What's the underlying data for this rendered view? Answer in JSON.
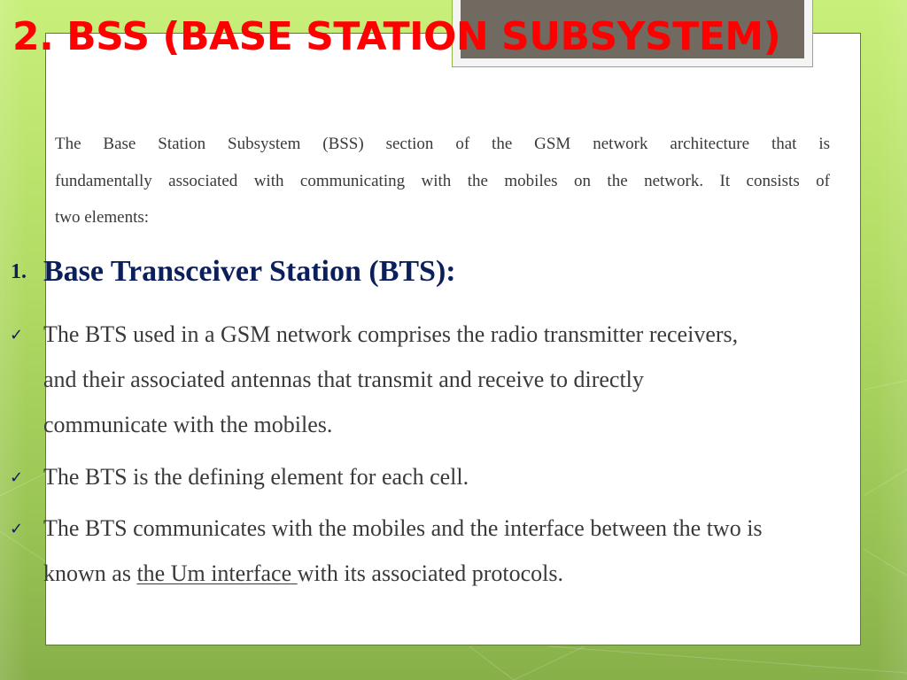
{
  "slide": {
    "title": "2. BSS (BASE STATION SUBSYSTEM)",
    "intro_lines": [
      "The Base Station Subsystem (BSS) section of the GSM network architecture that is",
      "fundamentally associated with communicating with the mobiles on the network. It consists of",
      "two elements:"
    ],
    "section": {
      "number": "1.",
      "heading": "Base Transceiver Station (BTS):"
    },
    "bullet_icon": "check-mark-icon",
    "bullets": [
      {
        "lines": [
          " The BTS used in a GSM network comprises the radio transmitter receivers,",
          "and their associated antennas that transmit and receive to directly",
          "communicate with the mobiles."
        ]
      },
      {
        "lines": [
          "The BTS is the defining element for each cell."
        ]
      },
      {
        "line1": "The BTS communicates with the mobiles and the interface between the two is",
        "line2_prefix": "known as ",
        "line2_underlined": "the Um interface ",
        "line2_suffix": "with its associated protocols."
      }
    ],
    "colors": {
      "title": "#ff0000",
      "heading": "#0b1f5c",
      "body": "#3a3a3a",
      "title_box": "#706a60",
      "background": "#b2dc65"
    }
  }
}
